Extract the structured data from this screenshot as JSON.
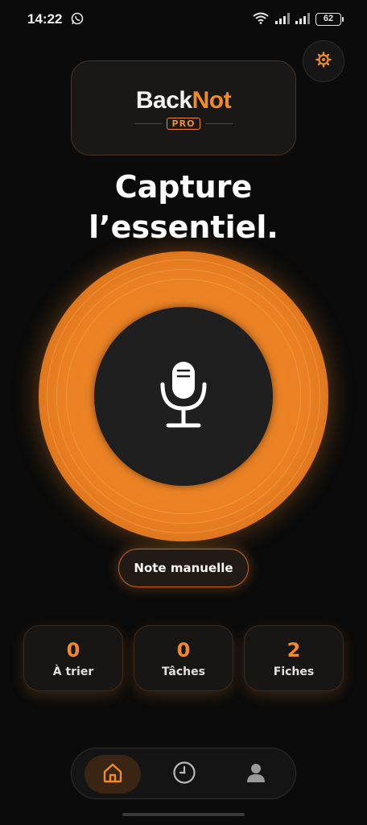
{
  "status_bar": {
    "time": "14:22",
    "battery": "62",
    "icons": [
      "whatsapp-icon",
      "wifi-icon",
      "signal-icon",
      "signal-icon",
      "battery-icon"
    ]
  },
  "header": {
    "settings_icon": "gear-icon"
  },
  "logo": {
    "back": "Back",
    "not": "Not",
    "badge": "PRO"
  },
  "headline": {
    "line1": "Capture",
    "line2": "l’essentiel."
  },
  "record": {
    "icon": "microphone-icon"
  },
  "manual_note": {
    "label": "Note manuelle"
  },
  "stats": [
    {
      "value": "0",
      "label": "À trier"
    },
    {
      "value": "0",
      "label": "Tâches"
    },
    {
      "value": "2",
      "label": "Fiches"
    }
  ],
  "nav": {
    "items": [
      {
        "icon": "home-icon",
        "active": true
      },
      {
        "icon": "clock-icon",
        "active": false
      },
      {
        "icon": "user-icon",
        "active": false
      }
    ]
  },
  "colors": {
    "accent": "#f08a2a",
    "background": "#0b0b0b",
    "card": "#181614"
  }
}
